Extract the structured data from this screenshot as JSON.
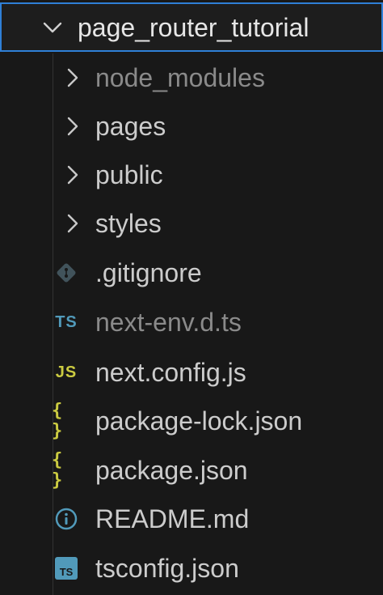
{
  "root": {
    "label": "page_router_tutorial",
    "expanded": true
  },
  "items": [
    {
      "type": "folder",
      "label": "node_modules",
      "dimmed": true
    },
    {
      "type": "folder",
      "label": "pages",
      "dimmed": false
    },
    {
      "type": "folder",
      "label": "public",
      "dimmed": false
    },
    {
      "type": "folder",
      "label": "styles",
      "dimmed": false
    },
    {
      "type": "file",
      "label": ".gitignore",
      "icon": "git-icon",
      "dimmed": false
    },
    {
      "type": "file",
      "label": "next-env.d.ts",
      "icon": "typescript-icon",
      "icon_text": "TS",
      "dimmed": true
    },
    {
      "type": "file",
      "label": "next.config.js",
      "icon": "javascript-icon",
      "icon_text": "JS",
      "dimmed": false
    },
    {
      "type": "file",
      "label": "package-lock.json",
      "icon": "json-icon",
      "icon_text": "{ }",
      "dimmed": false
    },
    {
      "type": "file",
      "label": "package.json",
      "icon": "json-icon",
      "icon_text": "{ }",
      "dimmed": false
    },
    {
      "type": "file",
      "label": "README.md",
      "icon": "info-icon",
      "dimmed": false
    },
    {
      "type": "file",
      "label": "tsconfig.json",
      "icon": "tsconfig-icon",
      "icon_text": "TS",
      "dimmed": false
    }
  ],
  "colors": {
    "background": "#181818",
    "text": "#cccccc",
    "dimmed_text": "#8a8a8a",
    "focus_border": "#2f7fd6",
    "ts_blue": "#519aba",
    "js_yellow": "#cbcb41",
    "json_yellow": "#cbcb41",
    "git_gray": "#41535b"
  }
}
